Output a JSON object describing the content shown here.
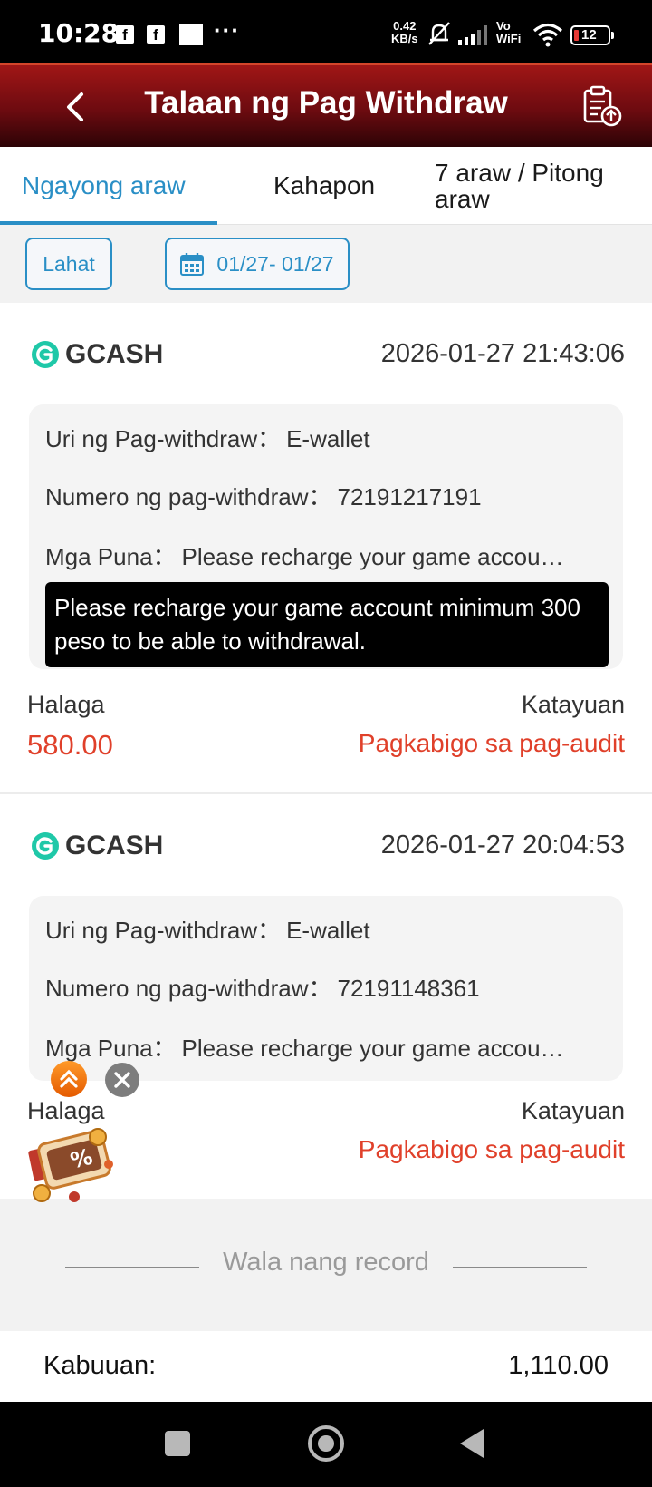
{
  "status_bar": {
    "time": "10:28",
    "fb1": "f",
    "fb2": "f",
    "dots": "···",
    "speed_value": "0.42",
    "speed_unit": "KB/s",
    "vo": "Vo",
    "wifi_label": "WiFi",
    "battery": "12"
  },
  "header": {
    "title": "Talaan ng Pag Withdraw",
    "bg_color": "#7a0c12"
  },
  "tabs": [
    {
      "label": "Ngayong araw",
      "active": true
    },
    {
      "label": "Kahapon",
      "active": false
    },
    {
      "label": "7 araw / Pitong araw",
      "active": false
    }
  ],
  "filters": {
    "all_label": "Lahat",
    "date_range": "01/27- 01/27"
  },
  "records": [
    {
      "provider": "GCASH",
      "datetime": "2026-01-27 21:43:06",
      "type_label": "Uri ng Pag-withdraw：",
      "type_value": "E-wallet",
      "number_label": "Numero ng pag-withdraw：",
      "number_value": "72191217191",
      "remarks_label": "Mga Puna：",
      "remarks_value": "Please recharge your game account minimum 300 peso to be able to withdrawal.",
      "remarks_short": "Please recharge your game accou…",
      "tooltip": "Please recharge your game account minimum 300 peso to be able to withdrawal.",
      "amount_label": "Halaga",
      "amount": "580.00",
      "status_label": "Katayuan",
      "status": "Pagkabigo sa pag-audit"
    },
    {
      "provider": "GCASH",
      "datetime": "2026-01-27 20:04:53",
      "type_label": "Uri ng Pag-withdraw：",
      "type_value": "E-wallet",
      "number_label": "Numero ng pag-withdraw：",
      "number_value": "72191148361",
      "remarks_label": "Mga Puna：",
      "remarks_short": "Please recharge your game accou…",
      "amount_label": "Halaga",
      "status_label": "Katayuan",
      "status": "Pagkabigo sa pag-audit"
    }
  ],
  "no_more": "Wala nang record",
  "total": {
    "label": "Kabuuan:",
    "value": "1,110.00"
  },
  "colors": {
    "accent": "#2a8fc6",
    "error": "#e0402a",
    "gcash": "#1fc8a8"
  },
  "icons": [
    "back-arrow-icon",
    "record-upload-icon",
    "calendar-icon",
    "gcash-logo-icon",
    "chevron-up-icon",
    "close-icon",
    "promo-gift-icon"
  ]
}
